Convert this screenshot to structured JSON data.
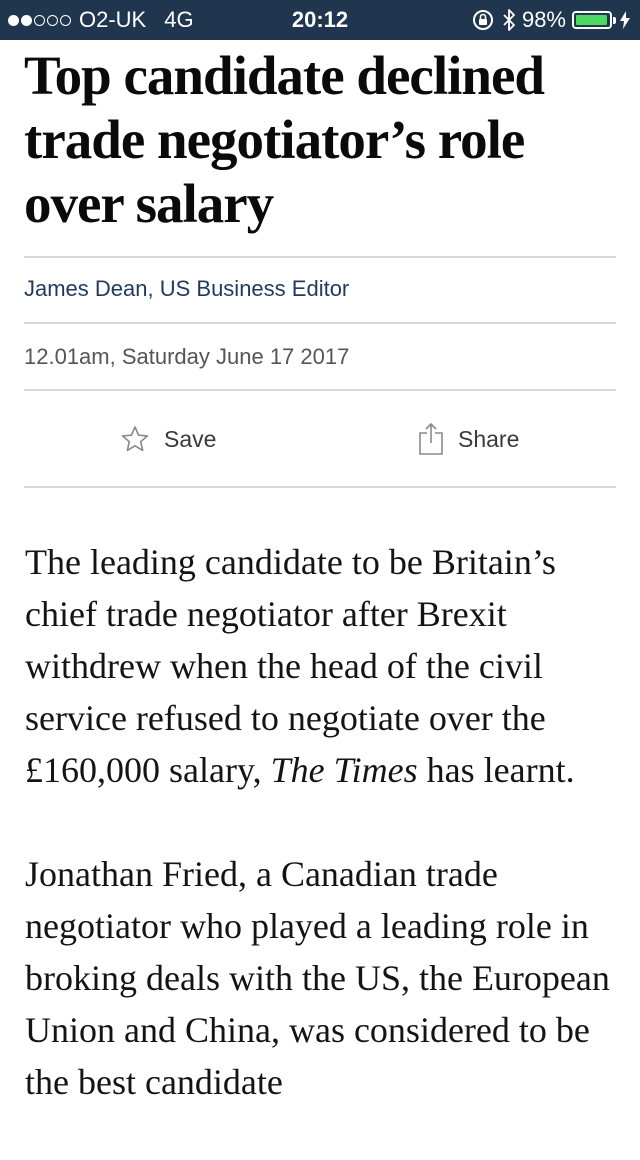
{
  "status_bar": {
    "carrier": "O2-UK",
    "network": "4G",
    "time": "20:12",
    "battery_percent": "98%",
    "battery_level": 0.98,
    "signal_bars_filled": 2,
    "signal_bars_total": 5,
    "icons": [
      "orientation-lock-icon",
      "bluetooth-icon",
      "battery-icon",
      "charging-bolt-icon"
    ],
    "background_color": "#20364e",
    "battery_color": "#4cd964"
  },
  "article": {
    "headline": "Top candidate declined trade negotiator’s role over salary",
    "byline": "James Dean, US Business Editor",
    "dateline": "12.01am, Saturday June 17 2017",
    "actions": {
      "save_label": "Save",
      "save_icon": "star-icon",
      "share_label": "Share",
      "share_icon": "share-icon"
    },
    "paragraph1": {
      "text": "The leading candidate to be Britain’s chief trade negotiator after Brexit withdrew when the head of the civil service refused to negotiate over the £160,000 salary, ",
      "emphasis": "The Times",
      "tail": " has learnt."
    },
    "paragraph2": "Jonathan Fried, a Canadian trade negotiator who played a leading role in broking deals with the US, the European Union and China, was considered to be the best candidate"
  }
}
